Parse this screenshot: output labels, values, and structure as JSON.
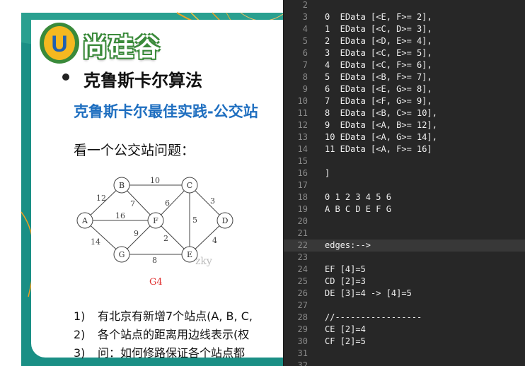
{
  "slide": {
    "logo_text": "尚硅谷",
    "logo_letter": "U",
    "bullet_title": "克鲁斯卡尔算法",
    "sub_title": "克鲁斯卡尔最佳实践-公交站",
    "question": "看一个公交站问题：",
    "graph": {
      "caption": "G4",
      "nodes": [
        "A",
        "B",
        "C",
        "D",
        "E",
        "F",
        "G"
      ],
      "edge_weights": [
        "10",
        "12",
        "7",
        "6",
        "3",
        "16",
        "9",
        "2",
        "5",
        "4",
        "14",
        "8"
      ]
    },
    "watermark": "zky",
    "list": [
      {
        "num": "1)",
        "text": "有北京有新增7个站点(A, B, C,"
      },
      {
        "num": "2)",
        "text": "各个站点的距离用边线表示(权"
      },
      {
        "num": "3)",
        "text": "问：如何修路保证各个站点都"
      }
    ],
    "colors": {
      "teal": "#1a8f85",
      "orange": "#f0a020",
      "subtitle_blue": "#1f6fc0",
      "caption_red": "#e03030"
    }
  },
  "editor": {
    "lines": [
      {
        "n": "2",
        "t": ""
      },
      {
        "n": "3",
        "t": "0  EData [<E, F>= 2],"
      },
      {
        "n": "4",
        "t": "1  EData [<C, D>= 3],"
      },
      {
        "n": "5",
        "t": "2  EData [<D, E>= 4],"
      },
      {
        "n": "6",
        "t": "3  EData [<C, E>= 5],"
      },
      {
        "n": "7",
        "t": "4  EData [<C, F>= 6],"
      },
      {
        "n": "8",
        "t": "5  EData [<B, F>= 7],"
      },
      {
        "n": "9",
        "t": "6  EData [<E, G>= 8],"
      },
      {
        "n": "10",
        "t": "7  EData [<F, G>= 9],"
      },
      {
        "n": "11",
        "t": "8  EData [<B, C>= 10],"
      },
      {
        "n": "12",
        "t": "9  EData [<A, B>= 12],"
      },
      {
        "n": "13",
        "t": "10 EData [<A, G>= 14],"
      },
      {
        "n": "14",
        "t": "11 EData [<A, F>= 16]"
      },
      {
        "n": "15",
        "t": ""
      },
      {
        "n": "16",
        "t": "]"
      },
      {
        "n": "17",
        "t": ""
      },
      {
        "n": "18",
        "t": "0 1 2 3 4 5 6"
      },
      {
        "n": "19",
        "t": "A B C D E F G"
      },
      {
        "n": "20",
        "t": ""
      },
      {
        "n": "21",
        "t": ""
      },
      {
        "n": "22",
        "t": "edges:-->",
        "highlight": true
      },
      {
        "n": "23",
        "t": ""
      },
      {
        "n": "24",
        "t": "EF [4]=5"
      },
      {
        "n": "25",
        "t": "CD [2]=3"
      },
      {
        "n": "26",
        "t": "DE [3]=4 -> [4]=5"
      },
      {
        "n": "27",
        "t": ""
      },
      {
        "n": "28",
        "t": "//-----------------"
      },
      {
        "n": "29",
        "t": "CE [2]=4"
      },
      {
        "n": "30",
        "t": "CF [2]=5"
      },
      {
        "n": "31",
        "t": ""
      },
      {
        "n": "32",
        "t": ""
      }
    ],
    "colors": {
      "background": "#272727",
      "text": "#f0f0f0",
      "line_number": "#8a8a8a",
      "current_line": "#383838"
    }
  }
}
